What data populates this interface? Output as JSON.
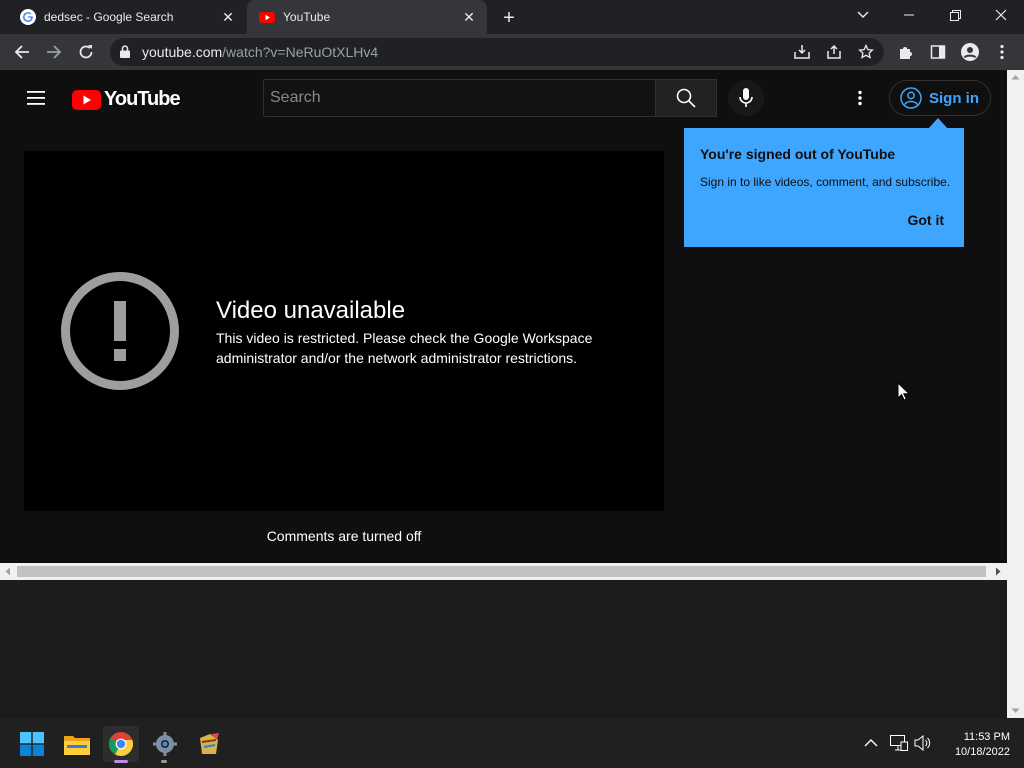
{
  "browser": {
    "tabs": [
      {
        "title": "dedsec - Google Search",
        "favicon": "google-favicon-icon"
      },
      {
        "title": "YouTube",
        "favicon": "youtube-favicon-icon"
      }
    ],
    "url_host": "youtube.com",
    "url_path": "/watch?v=NeRuOtXLHv4"
  },
  "youtube": {
    "logo_text": "YouTube",
    "search_placeholder": "Search",
    "sign_in_label": "Sign in",
    "signed_out_tooltip": {
      "title": "You're signed out of YouTube",
      "body": "Sign in to like videos, comment, and subscribe.",
      "button": "Got it"
    },
    "player": {
      "error_title": "Video unavailable",
      "error_message_line1": "This video is restricted. Please check the Google Workspace",
      "error_message_line2": "administrator and/or the network administrator restrictions."
    },
    "comments_status": "Comments are turned off"
  },
  "taskbar": {
    "time": "11:53 PM",
    "date": "10/18/2022",
    "apps": [
      "windows-start-icon",
      "file-explorer-icon",
      "chrome-icon",
      "settings-icon",
      "app-icon"
    ]
  },
  "colors": {
    "accent_blue": "#3ea6ff",
    "youtube_red": "#ff0000",
    "page_bg": "#0f0f0f"
  }
}
